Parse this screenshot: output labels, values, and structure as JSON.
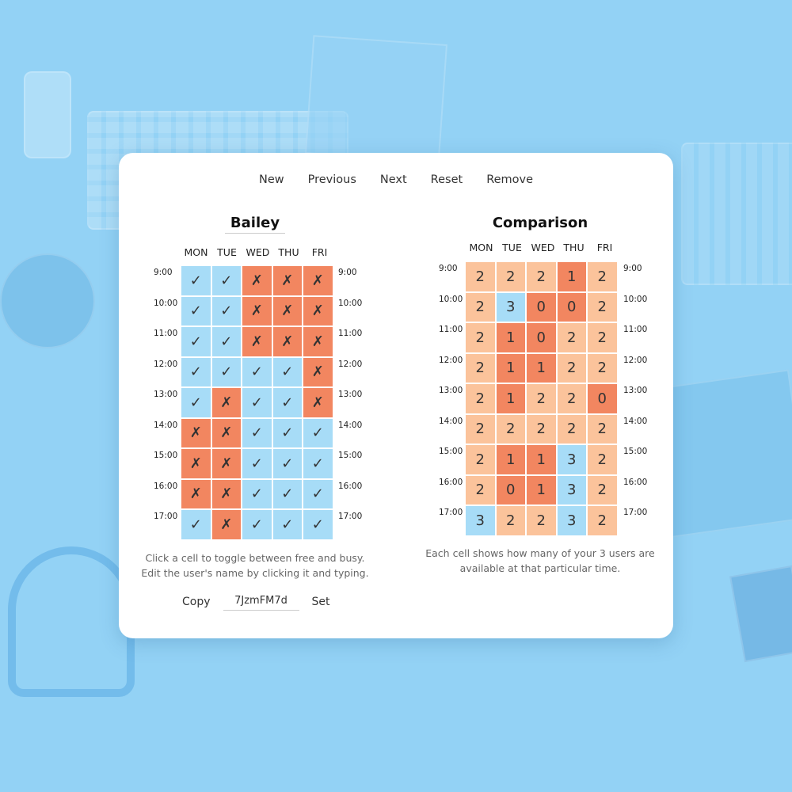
{
  "menu": [
    "New",
    "Previous",
    "Next",
    "Reset",
    "Remove"
  ],
  "user": {
    "name": "Bailey",
    "days": [
      "MON",
      "TUE",
      "WED",
      "THU",
      "FRI"
    ],
    "times": [
      "9:00",
      "10:00",
      "11:00",
      "12:00",
      "13:00",
      "14:00",
      "15:00",
      "16:00",
      "17:00"
    ],
    "free_symbol": "✓",
    "busy_symbol": "✗",
    "schedule": [
      [
        1,
        1,
        0,
        0,
        0
      ],
      [
        1,
        1,
        0,
        0,
        0
      ],
      [
        1,
        1,
        0,
        0,
        0
      ],
      [
        1,
        1,
        1,
        1,
        0
      ],
      [
        1,
        0,
        1,
        1,
        0
      ],
      [
        0,
        0,
        1,
        1,
        1
      ],
      [
        0,
        0,
        1,
        1,
        1
      ],
      [
        0,
        0,
        1,
        1,
        1
      ],
      [
        1,
        0,
        1,
        1,
        1
      ]
    ],
    "help_line1": "Click a cell to toggle between free and busy.",
    "help_line2": "Edit the user's name by clicking it and typing.",
    "copy_label": "Copy",
    "code_value": "7JzmFM7d",
    "set_label": "Set"
  },
  "comparison": {
    "title": "Comparison",
    "days": [
      "MON",
      "TUE",
      "WED",
      "THU",
      "FRI"
    ],
    "times": [
      "9:00",
      "10:00",
      "11:00",
      "12:00",
      "13:00",
      "14:00",
      "15:00",
      "16:00",
      "17:00"
    ],
    "counts": [
      [
        2,
        2,
        2,
        1,
        2
      ],
      [
        2,
        3,
        0,
        0,
        2
      ],
      [
        2,
        1,
        0,
        2,
        2
      ],
      [
        2,
        1,
        1,
        2,
        2
      ],
      [
        2,
        1,
        2,
        2,
        0
      ],
      [
        2,
        2,
        2,
        2,
        2
      ],
      [
        2,
        1,
        1,
        3,
        2
      ],
      [
        2,
        0,
        1,
        3,
        2
      ],
      [
        3,
        2,
        2,
        3,
        2
      ]
    ],
    "help_line1": "Each cell shows how many of your 3 users are",
    "help_line2": "available at that particular time."
  },
  "colors": {
    "free": "#a7dcf7",
    "busy": "#f28660",
    "partial": "#fbc39b",
    "background": "#93d2f5"
  }
}
